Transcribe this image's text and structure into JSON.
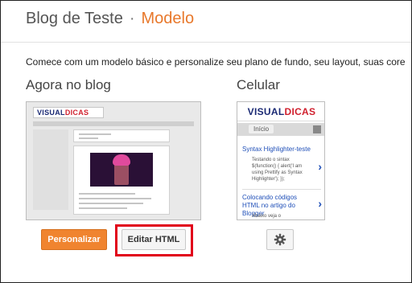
{
  "header": {
    "blog_name": "Blog de Teste",
    "separator": "·",
    "page_title": "Modelo"
  },
  "intro_text": "Comece com um modelo básico e personalize seu plano de fundo, seu layout, suas cores,",
  "sections": {
    "current": {
      "title": "Agora no blog"
    },
    "mobile": {
      "title": "Celular"
    }
  },
  "desktop_preview": {
    "logo_part1": "VISUAL",
    "logo_part2": "DICAS"
  },
  "mobile_preview": {
    "logo_part1": "VISUAL",
    "logo_part2": "DICAS",
    "home_label": "Início",
    "posts": [
      {
        "title": "Syntax Highlighter-teste",
        "snippet": "Testando o sintax $(function() { alert('I am using Prettify as Syntax Highlighter'); });"
      },
      {
        "title": "Colocando códigos HTML no artigo do Blogger",
        "snippet": "Abaixo veja o"
      }
    ]
  },
  "buttons": {
    "customize": "Personalizar",
    "edit_html": "Editar HTML",
    "mobile_settings_icon": "gear-icon"
  },
  "colors": {
    "accent_orange": "#e8782b",
    "primary_button": "#f0842f",
    "highlight_red": "#e1001a",
    "link_blue": "#1f4fb8"
  }
}
